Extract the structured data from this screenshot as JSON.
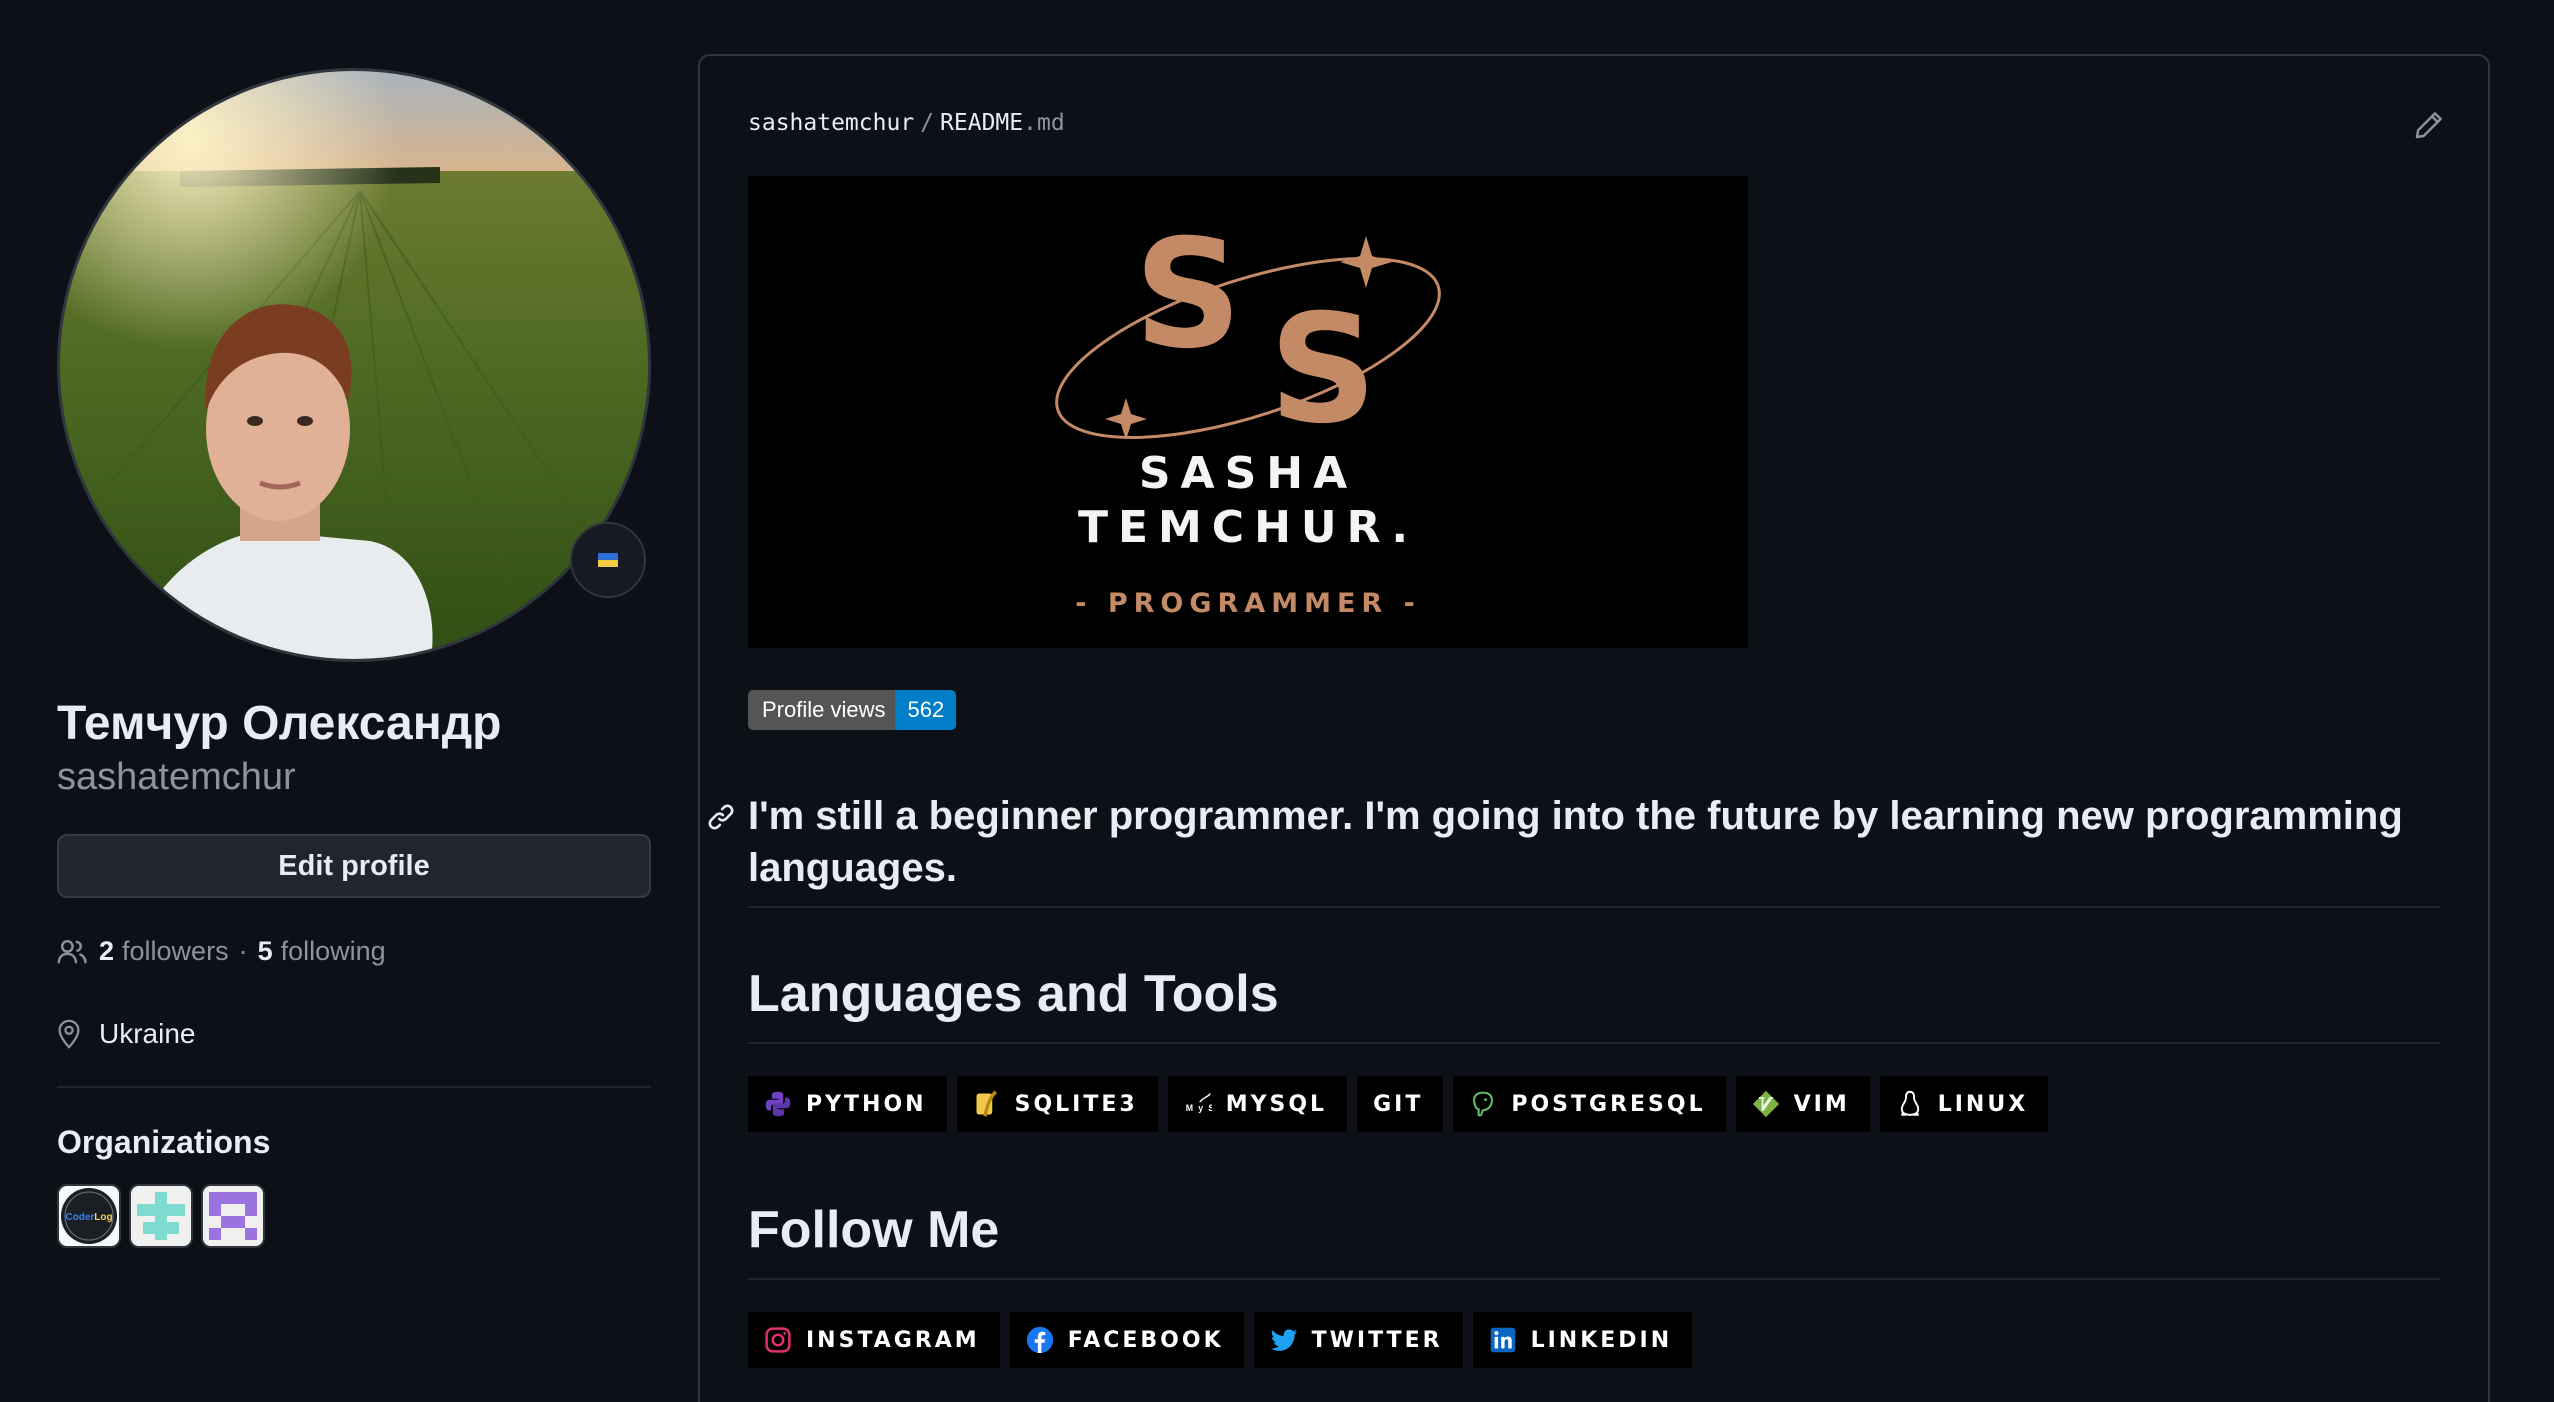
{
  "profile": {
    "full_name": "Темчур Олександр",
    "username": "sashatemchur",
    "edit_label": "Edit profile",
    "followers_count": "2",
    "followers_label": "followers",
    "following_count": "5",
    "following_label": "following",
    "separator": "·",
    "location": "Ukraine",
    "status_emoji": "ukraine-flag-icon"
  },
  "organizations": {
    "title": "Organizations",
    "items": [
      {
        "name": "CoderLog",
        "text": "CoderLog",
        "colors": [
          "#1b1f24",
          "#2f81f7",
          "#f2cc60"
        ]
      },
      {
        "name": "org-teal",
        "colors": [
          "#7fdad0"
        ]
      },
      {
        "name": "org-purple",
        "colors": [
          "#9b73e0"
        ]
      }
    ]
  },
  "readme": {
    "owner": "sashatemchur",
    "slash": "/",
    "file_base": "README",
    "file_ext": ".md",
    "banner": {
      "line1": "SASHA",
      "line2": "TEMCHUR.",
      "line3": "- PROGRAMMER -",
      "colors": {
        "background": "#000000",
        "accent": "#c48a66",
        "text": "#f4f4f4"
      }
    },
    "views_label": "Profile views",
    "views_count": "562",
    "intro": "I'm still a beginner programmer. I'm going into the future by learning new programming languages.",
    "languages_heading": "Languages and Tools",
    "languages": [
      {
        "label": "PYTHON",
        "icon": "python-icon",
        "color": "#6f42c1"
      },
      {
        "label": "SQLITE3",
        "icon": "sqlite-icon",
        "color": "#f2c94c"
      },
      {
        "label": "MYSQL",
        "icon": "mysql-icon",
        "color": "#ffffff"
      },
      {
        "label": "GIT",
        "icon": "",
        "color": "#ffffff"
      },
      {
        "label": "POSTGRESQL",
        "icon": "postgresql-icon",
        "color": "#66bb6a"
      },
      {
        "label": "VIM",
        "icon": "vim-icon",
        "color": "#7cb342"
      },
      {
        "label": "LINUX",
        "icon": "linux-icon",
        "color": "#ffffff"
      }
    ],
    "follow_heading": "Follow Me",
    "social": [
      {
        "label": "INSTAGRAM",
        "icon": "instagram-icon",
        "color": "#e1306c"
      },
      {
        "label": "FACEBOOK",
        "icon": "facebook-icon",
        "color": "#1877f2"
      },
      {
        "label": "TWITTER",
        "icon": "twitter-icon",
        "color": "#1da1f2"
      },
      {
        "label": "LINKEDIN",
        "icon": "linkedin-icon",
        "color": "#0a66c2"
      }
    ]
  },
  "colors": {
    "background": "#0d1117",
    "text": "#e6edf3",
    "muted": "#8b949e",
    "border": "#30363d",
    "button_bg": "#21262d"
  }
}
